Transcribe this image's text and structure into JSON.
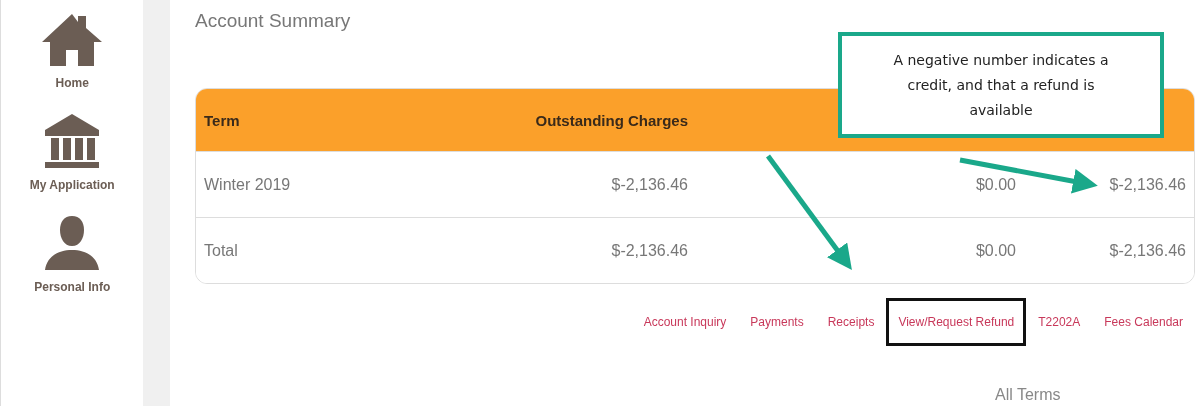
{
  "sidebar": {
    "items": [
      {
        "label": "Home"
      },
      {
        "label": "My Application"
      },
      {
        "label": "Personal Info"
      }
    ]
  },
  "title": "Account Summary",
  "table": {
    "columns": [
      {
        "label": "Term"
      },
      {
        "label": "Outstanding Charges"
      },
      {},
      {}
    ],
    "rows": [
      {
        "cells": [
          "Winter 2019",
          "$-2,136.46",
          "$0.00",
          "$-2,136.46"
        ]
      },
      {
        "cells": [
          "Total",
          "$-2,136.46",
          "$0.00",
          "$-2,136.46"
        ]
      }
    ]
  },
  "links": [
    {
      "label": "Account Inquiry",
      "highlighted": false
    },
    {
      "label": "Payments",
      "highlighted": false
    },
    {
      "label": "Receipts",
      "highlighted": false
    },
    {
      "label": "View/Request Refund",
      "highlighted": true
    },
    {
      "label": "T2202A",
      "highlighted": false
    },
    {
      "label": "Fees Calendar",
      "highlighted": false
    }
  ],
  "footer_text": "All Terms",
  "callout": {
    "text": "A negative number indicates a credit, and that a refund is available"
  }
}
